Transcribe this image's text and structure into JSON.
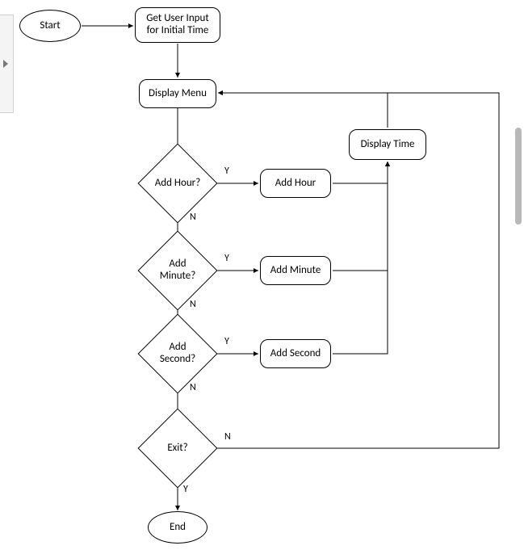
{
  "nodes": {
    "start": "Start",
    "getInput": "Get User Input for Initial Time",
    "displayMenu": "Display Menu",
    "displayTime": "Display Time",
    "addHourQ": "Add Hour?",
    "addHour": "Add Hour",
    "addMinuteQ": "Add Minute?",
    "addMinute": "Add Minute",
    "addSecondQ": "Add Second?",
    "addSecond": "Add Second",
    "exitQ": "Exit?",
    "end": "End"
  },
  "labels": {
    "y": "Y",
    "n": "N"
  },
  "chart_data": {
    "type": "flowchart",
    "nodes": [
      {
        "id": "start",
        "shape": "terminator",
        "label": "Start"
      },
      {
        "id": "getInput",
        "shape": "process",
        "label": "Get User Input for Initial Time"
      },
      {
        "id": "displayMenu",
        "shape": "process",
        "label": "Display Menu"
      },
      {
        "id": "addHourQ",
        "shape": "decision",
        "label": "Add Hour?"
      },
      {
        "id": "addHour",
        "shape": "process",
        "label": "Add Hour"
      },
      {
        "id": "addMinuteQ",
        "shape": "decision",
        "label": "Add Minute?"
      },
      {
        "id": "addMinute",
        "shape": "process",
        "label": "Add Minute"
      },
      {
        "id": "addSecondQ",
        "shape": "decision",
        "label": "Add Second?"
      },
      {
        "id": "addSecond",
        "shape": "process",
        "label": "Add Second"
      },
      {
        "id": "exitQ",
        "shape": "decision",
        "label": "Exit?"
      },
      {
        "id": "displayTime",
        "shape": "process",
        "label": "Display Time"
      },
      {
        "id": "end",
        "shape": "terminator",
        "label": "End"
      }
    ],
    "edges": [
      {
        "from": "start",
        "to": "getInput"
      },
      {
        "from": "getInput",
        "to": "displayMenu"
      },
      {
        "from": "displayMenu",
        "to": "addHourQ"
      },
      {
        "from": "addHourQ",
        "to": "addHour",
        "label": "Y"
      },
      {
        "from": "addHourQ",
        "to": "addMinuteQ",
        "label": "N"
      },
      {
        "from": "addMinuteQ",
        "to": "addMinute",
        "label": "Y"
      },
      {
        "from": "addMinuteQ",
        "to": "addSecondQ",
        "label": "N"
      },
      {
        "from": "addSecondQ",
        "to": "addSecond",
        "label": "Y"
      },
      {
        "from": "addSecondQ",
        "to": "exitQ",
        "label": "N"
      },
      {
        "from": "addHour",
        "to": "displayTime"
      },
      {
        "from": "addMinute",
        "to": "displayTime"
      },
      {
        "from": "addSecond",
        "to": "displayTime"
      },
      {
        "from": "displayTime",
        "to": "displayMenu"
      },
      {
        "from": "exitQ",
        "to": "displayMenu",
        "label": "N"
      },
      {
        "from": "exitQ",
        "to": "end",
        "label": "Y"
      }
    ]
  }
}
